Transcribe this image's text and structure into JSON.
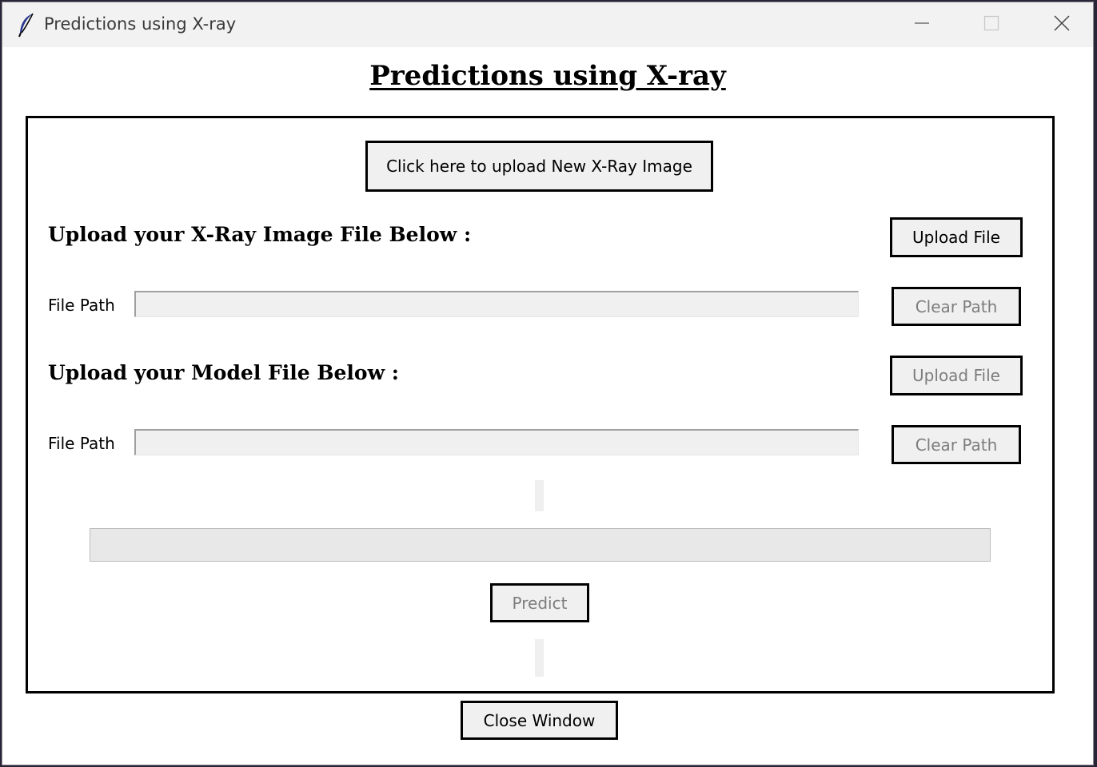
{
  "window": {
    "title": "Predictions using X-ray",
    "app_icon": "feather-icon",
    "controls": [
      "minimize-icon",
      "maximize-icon",
      "close-icon"
    ]
  },
  "heading": "Predictions using X-ray",
  "buttons": {
    "upload_new_image": "Click here to upload New X-Ray Image",
    "upload_image_file": "Upload File",
    "clear_image_path": "Clear Path",
    "upload_model_file": "Upload File",
    "clear_model_path": "Clear Path",
    "predict": "Predict",
    "close_window": "Close Window"
  },
  "sections": {
    "image_label": "Upload your X-Ray Image File Below :",
    "model_label": "Upload your Model File Below :"
  },
  "fields": {
    "image_path_label": "File Path",
    "image_path_value": "",
    "model_path_label": "File Path",
    "model_path_value": ""
  },
  "prediction_result": "",
  "colors": {
    "window_bg": "#ffffff",
    "titlebar_bg": "#f2f2f2",
    "button_bg": "#f0f0f0",
    "disabled_text": "#7d7d7d",
    "border": "#000000"
  }
}
